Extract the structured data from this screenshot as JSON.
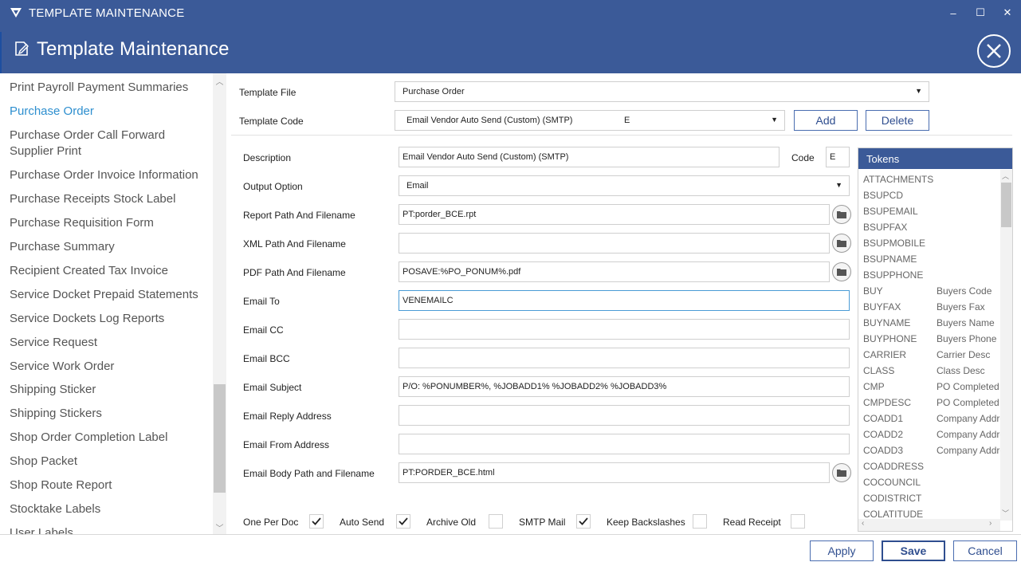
{
  "window": {
    "title": "TEMPLATE MAINTENANCE",
    "minimize": "–",
    "maximize": "☐",
    "close": "✕"
  },
  "header": {
    "title": "Template Maintenance"
  },
  "sidebar": {
    "items": [
      "Print Payroll Payment Summaries",
      "Purchase Order",
      "Purchase Order Call Forward Supplier Print",
      "Purchase Order Invoice Information",
      "Purchase Receipts Stock Label",
      "Purchase Requisition Form",
      "Purchase Summary",
      "Recipient Created Tax Invoice",
      "Service Docket Prepaid Statements",
      "Service Dockets Log Reports",
      "Service Request",
      "Service Work Order",
      "Shipping Sticker",
      "Shipping Stickers",
      "Shop Order Completion Label",
      "Shop Packet",
      "Shop Route Report",
      "Stocktake Labels",
      "User Labels"
    ],
    "active_index": 1
  },
  "template": {
    "file_label": "Template File",
    "file_value": "Purchase Order",
    "code_label": "Template Code",
    "code_value": "Email Vendor Auto Send (Custom) (SMTP)",
    "code_suffix": "E",
    "add_label": "Add",
    "delete_label": "Delete"
  },
  "form": {
    "description_label": "Description",
    "description_value": "Email Vendor Auto Send (Custom) (SMTP)",
    "code_label": "Code",
    "code_value": "E",
    "output_label": "Output Option",
    "output_value": "Email",
    "report_label": "Report Path And Filename",
    "report_value": "PT:porder_BCE.rpt",
    "xml_label": "XML Path And Filename",
    "xml_value": "",
    "pdf_label": "PDF Path And Filename",
    "pdf_value": "POSAVE:%PO_PONUM%.pdf",
    "email_to_label": "Email To",
    "email_to_value": "VENEMAILC",
    "email_cc_label": "Email CC",
    "email_cc_value": "",
    "email_bcc_label": "Email BCC",
    "email_bcc_value": "",
    "subject_label": "Email Subject",
    "subject_value": "P/O: %PONUMBER%, %JOBADD1% %JOBADD2% %JOBADD3%",
    "reply_label": "Email Reply Address",
    "reply_value": "",
    "from_label": "Email From Address",
    "from_value": "",
    "body_label": "Email Body Path and Filename",
    "body_value": "PT:PORDER_BCE.html"
  },
  "options": [
    {
      "label": "One Per Doc",
      "checked": true
    },
    {
      "label": "Auto Send",
      "checked": true
    },
    {
      "label": "Archive Old",
      "checked": false
    },
    {
      "label": "SMTP Mail",
      "checked": true
    },
    {
      "label": "Keep Backslashes",
      "checked": false
    },
    {
      "label": "Read Receipt",
      "checked": false
    }
  ],
  "tokens": {
    "header": "Tokens",
    "rows": [
      {
        "code": "ATTACHMENTS",
        "desc": ""
      },
      {
        "code": "BSUPCD",
        "desc": ""
      },
      {
        "code": "BSUPEMAIL",
        "desc": ""
      },
      {
        "code": "BSUPFAX",
        "desc": ""
      },
      {
        "code": "BSUPMOBILE",
        "desc": ""
      },
      {
        "code": "BSUPNAME",
        "desc": ""
      },
      {
        "code": "BSUPPHONE",
        "desc": ""
      },
      {
        "code": "BUY",
        "desc": "Buyers Code"
      },
      {
        "code": "BUYFAX",
        "desc": "Buyers Fax"
      },
      {
        "code": "BUYNAME",
        "desc": "Buyers Name"
      },
      {
        "code": "BUYPHONE",
        "desc": "Buyers Phone"
      },
      {
        "code": "CARRIER",
        "desc": "Carrier Desc"
      },
      {
        "code": "CLASS",
        "desc": "Class Desc"
      },
      {
        "code": "CMP",
        "desc": "PO Completed"
      },
      {
        "code": "CMPDESC",
        "desc": "PO Completed"
      },
      {
        "code": "COADD1",
        "desc": "Company Address"
      },
      {
        "code": "COADD2",
        "desc": "Company Address"
      },
      {
        "code": "COADD3",
        "desc": "Company Address"
      },
      {
        "code": "COADDRESS",
        "desc": ""
      },
      {
        "code": "COCOUNCIL",
        "desc": ""
      },
      {
        "code": "CODISTRICT",
        "desc": ""
      },
      {
        "code": "COLATITUDE",
        "desc": ""
      }
    ]
  },
  "footer": {
    "apply": "Apply",
    "save": "Save",
    "cancel": "Cancel"
  }
}
